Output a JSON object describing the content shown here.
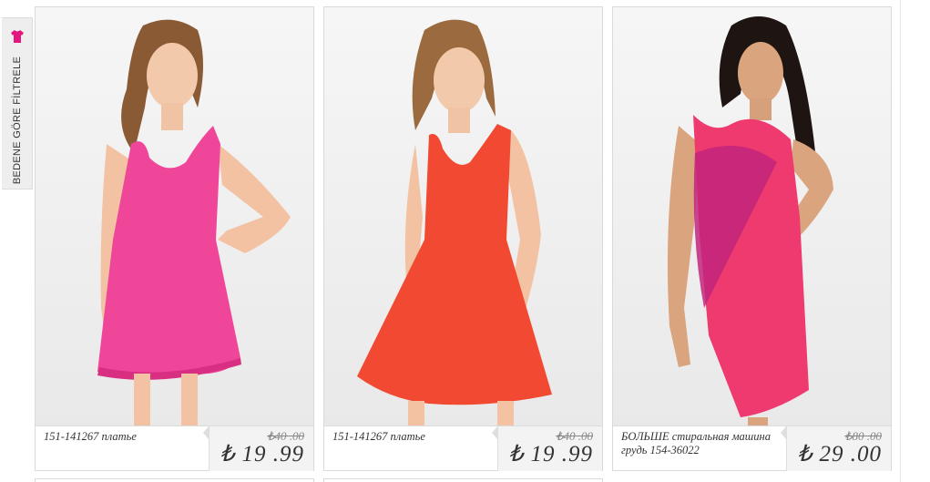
{
  "filter": {
    "label": "BEDENE GÖRE FİLTRELE",
    "icon": "tshirt-icon",
    "icon_color": "#e4157e"
  },
  "products": [
    {
      "name": "151-141267 платье",
      "old_price": "₺40 .00",
      "price": "₺ 19 .99",
      "dress_color": "#f0469a"
    },
    {
      "name": "151-141267 платье",
      "old_price": "₺40 .00",
      "price": "₺ 19 .99",
      "dress_color": "#f24a32"
    },
    {
      "name": "БОЛЬШЕ стиральная машина грудь 154-36022",
      "old_price": "₺80 .00",
      "price": "₺ 29 .00",
      "dress_color": "#ee3a6e"
    }
  ]
}
